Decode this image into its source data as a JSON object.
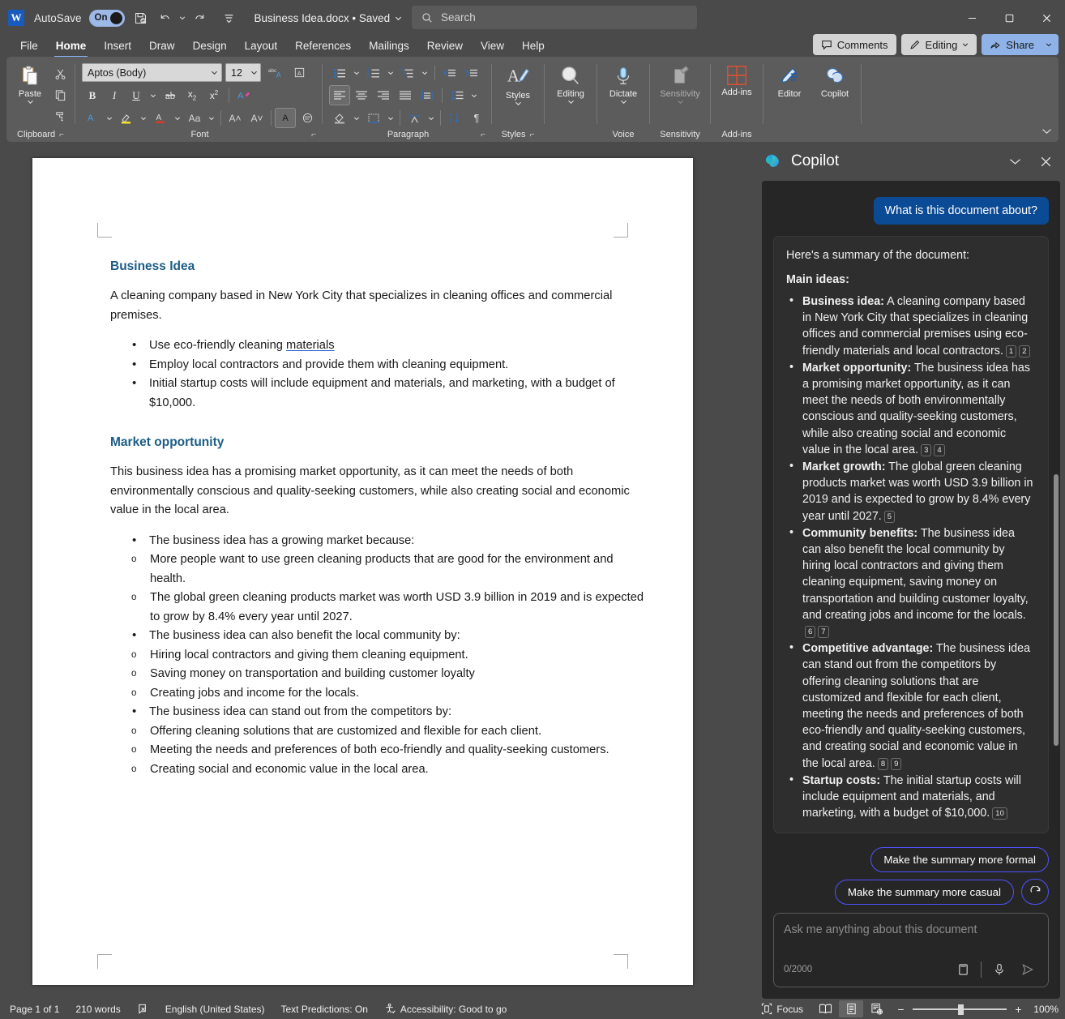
{
  "titlebar": {
    "app_icon": "word-logo-icon",
    "autosave_label": "AutoSave",
    "autosave_state": "On",
    "save_icon": "save-icon",
    "undo_icon": "undo-icon",
    "redo_icon": "redo-icon",
    "customize_icon": "customize-quick-access-icon",
    "document_title": "Business Idea.docx  •  Saved",
    "search_placeholder": "Search",
    "search_icon": "search-icon",
    "minimize": "minimize-icon",
    "maximize": "maximize-icon",
    "close": "close-icon"
  },
  "tabs": [
    {
      "label": "File",
      "active": false
    },
    {
      "label": "Home",
      "active": true
    },
    {
      "label": "Insert",
      "active": false
    },
    {
      "label": "Draw",
      "active": false
    },
    {
      "label": "Design",
      "active": false
    },
    {
      "label": "Layout",
      "active": false
    },
    {
      "label": "References",
      "active": false
    },
    {
      "label": "Mailings",
      "active": false
    },
    {
      "label": "Review",
      "active": false
    },
    {
      "label": "View",
      "active": false
    },
    {
      "label": "Help",
      "active": false
    }
  ],
  "tab_actions": {
    "comments": "Comments",
    "editing": "Editing",
    "share": "Share"
  },
  "ribbon": {
    "groups": [
      {
        "label": "Clipboard"
      },
      {
        "label": "Font"
      },
      {
        "label": "Paragraph"
      },
      {
        "label": "Styles"
      },
      {
        "label": "Voice"
      },
      {
        "label": "Sensitivity"
      },
      {
        "label": "Add-ins"
      }
    ],
    "paste_label": "Paste",
    "font_name": "Aptos (Body)",
    "font_size": "12",
    "styles_label": "Styles",
    "editing_label": "Editing",
    "dictate_label": "Dictate",
    "sensitivity_label": "Sensitivity",
    "addins_label": "Add-ins",
    "editor_label": "Editor",
    "copilot_label": "Copilot"
  },
  "document": {
    "heading1": "Business Idea",
    "para1": "A cleaning company based in New York City that specializes in cleaning offices and commercial premises.",
    "bullets1": [
      {
        "pre": "Use eco-friendly cleaning ",
        "underlined": "materials",
        "post": ""
      },
      {
        "pre": "Employ local contractors and provide them with cleaning equipment.",
        "underlined": "",
        "post": ""
      },
      {
        "pre": "Initial startup costs will include equipment and materials, and marketing, with a budget of $10,000.",
        "underlined": "",
        "post": ""
      }
    ],
    "heading2": "Market opportunity",
    "para2": "This business idea has a promising market opportunity, as it can meet the needs of both environmentally conscious and quality-seeking customers, while also creating social and economic value in the local area.",
    "outline": [
      {
        "text": "The business idea has a growing market because:",
        "sub": [
          "More people want to use green cleaning products that are good for the environment and health.",
          "The global green cleaning products market was worth USD 3.9 billion in 2019 and is expected to grow by 8.4% every year until 2027."
        ]
      },
      {
        "text": "The business idea can also benefit the local community by:",
        "sub": [
          "Hiring local contractors and giving them cleaning equipment.",
          "Saving money on transportation and building customer loyalty",
          "Creating jobs and income for the locals."
        ]
      },
      {
        "text": "The business idea can stand out from the competitors by:",
        "sub": [
          "Offering cleaning solutions that are customized and flexible for each client.",
          "Meeting the needs and preferences of both eco-friendly and quality-seeking customers.",
          "Creating social and economic value in the local area."
        ]
      }
    ]
  },
  "copilot": {
    "title": "Copilot",
    "logo_icon": "copilot-logo-icon",
    "collapse_icon": "chevron-down-icon",
    "close_icon": "close-icon",
    "user_message": "What is this document about?",
    "response_intro": "Here's a summary of the document:",
    "response_subhead": "Main ideas:",
    "response_points": [
      {
        "label": "Business idea:",
        "text": " A cleaning company based in New York City that specializes in cleaning offices and commercial premises using eco-friendly materials and local contractors.",
        "citations": [
          "1",
          "2"
        ]
      },
      {
        "label": "Market opportunity:",
        "text": " The business idea has a promising market opportunity, as it can meet the needs of both environmentally conscious and quality-seeking customers, while also creating social and economic value in the local area.",
        "citations": [
          "3",
          "4"
        ]
      },
      {
        "label": "Market growth:",
        "text": " The global green cleaning products market was worth USD 3.9 billion in 2019 and is expected to grow by 8.4% every year until 2027.",
        "citations": [
          "5"
        ]
      },
      {
        "label": "Community benefits:",
        "text": " The business idea can also benefit the local community by hiring local contractors and giving them cleaning equipment, saving money on transportation and building customer loyalty, and creating jobs and income for the locals.",
        "citations": [
          "6",
          "7"
        ]
      },
      {
        "label": "Competitive advantage:",
        "text": " The business idea can stand out from the competitors by offering cleaning solutions that are customized and flexible for each client, meeting the needs and preferences of both eco-friendly and quality-seeking customers, and creating social and economic value in the local area.",
        "citations": [
          "8",
          "9"
        ]
      },
      {
        "label": "Startup costs:",
        "text": " The initial startup costs will include equipment and materials, and marketing, with a budget of $10,000.",
        "citations": [
          "10"
        ]
      }
    ],
    "suggestion_formal": "Make the summary more formal",
    "suggestion_casual": "Make the summary more casual",
    "refresh_icon": "refresh-icon",
    "input_placeholder": "Ask me anything about this document",
    "char_counter": "0/2000",
    "prompt_guide_icon": "prompt-guide-icon",
    "mic_icon": "microphone-icon",
    "send_icon": "send-icon"
  },
  "statusbar": {
    "page": "Page 1 of 1",
    "words": "210 words",
    "proofing_icon": "proofing-errors-icon",
    "language": "English (United States)",
    "text_predictions": "Text Predictions: On",
    "accessibility_icon": "accessibility-icon",
    "accessibility": "Accessibility: Good to go",
    "focus_icon": "focus-icon",
    "focus": "Focus",
    "view_read": "read-mode-icon",
    "view_print": "print-layout-icon",
    "view_web": "web-layout-icon",
    "zoom_out": "−",
    "zoom_in": "+",
    "zoom_level": "100%"
  },
  "colors": {
    "accent_blue": "#185abd",
    "heading_blue": "#1b5d85",
    "copilot_purple": "#4f52ff",
    "user_bubble": "#0b4a94",
    "share_blue": "#8fb3e8"
  }
}
